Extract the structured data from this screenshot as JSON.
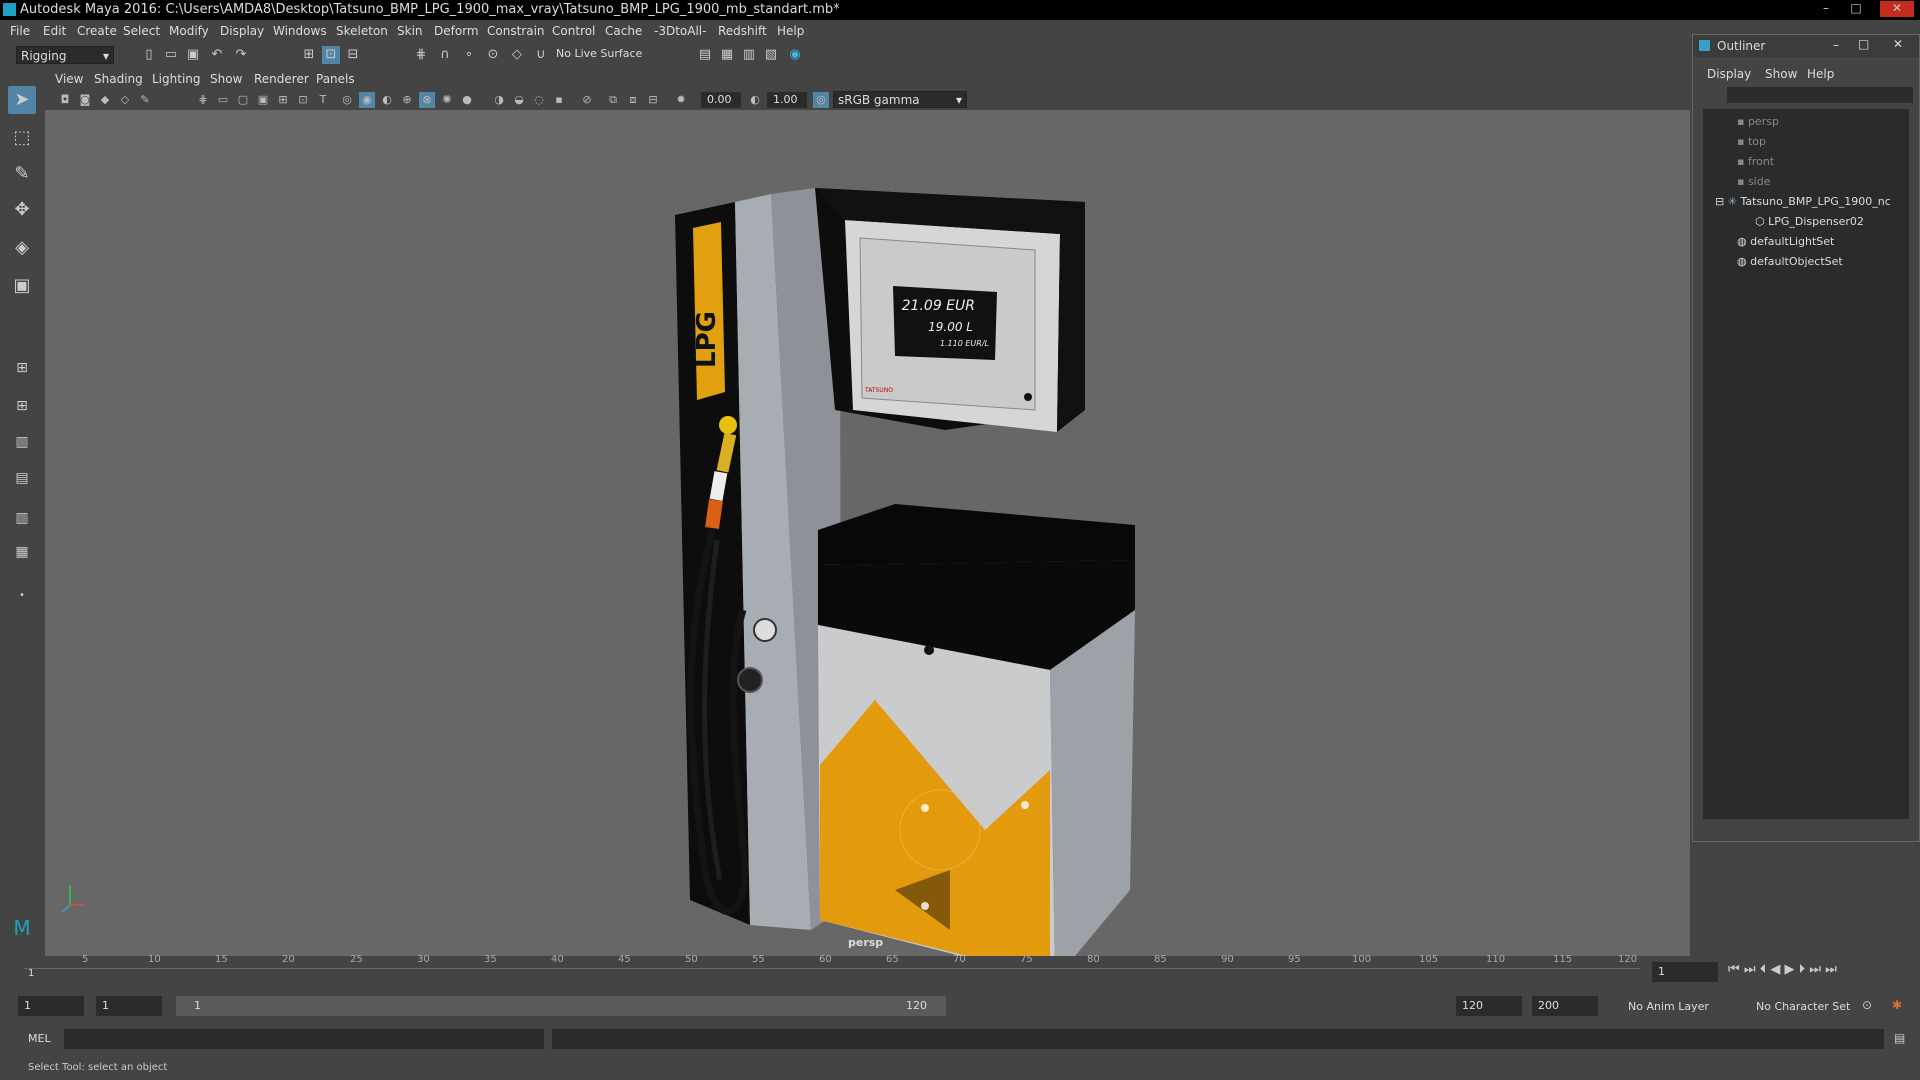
{
  "window": {
    "title": "Autodesk Maya 2016: C:\\Users\\AMDA8\\Desktop\\Tatsuno_BMP_LPG_1900_max_vray\\Tatsuno_BMP_LPG_1900_mb_standart.mb*",
    "buttons": [
      "–",
      "□",
      "✕"
    ]
  },
  "menubar": [
    "File",
    "Edit",
    "Create",
    "Select",
    "Modify",
    "Display",
    "Windows",
    "Skeleton",
    "Skin",
    "Deform",
    "Constrain",
    "Control",
    "Cache",
    "-3DtoAll-",
    "Redshift",
    "Help"
  ],
  "shelf": {
    "mode": "Rigging",
    "live_surface": "No Live Surface"
  },
  "viewport": {
    "menu": [
      "View",
      "Shading",
      "Lighting",
      "Show",
      "Renderer",
      "Panels"
    ],
    "exposure": "0.00",
    "gamma": "1.00",
    "color_space": "sRGB gamma",
    "camera_label": "persp"
  },
  "model": {
    "brand_label": "LPG",
    "display_line1": "21.09 EUR",
    "display_line2": "19.00 L",
    "display_line3": "1.110 EUR/L",
    "maker": "TATSUNO"
  },
  "outliner": {
    "title": "Outliner",
    "menu": [
      "Display",
      "Show",
      "Help"
    ],
    "items": [
      {
        "label": "persp",
        "dim": true
      },
      {
        "label": "top",
        "dim": true
      },
      {
        "label": "front",
        "dim": true
      },
      {
        "label": "side",
        "dim": true
      },
      {
        "label": "Tatsuno_BMP_LPG_1900_nc",
        "dim": false
      },
      {
        "label": "LPG_Dispenser02",
        "dim": false
      },
      {
        "label": "defaultLightSet",
        "dim": false
      },
      {
        "label": "defaultObjectSet",
        "dim": false
      }
    ]
  },
  "timeline": {
    "ticks": [
      "5",
      "10",
      "15",
      "20",
      "25",
      "30",
      "35",
      "40",
      "45",
      "50",
      "55",
      "60",
      "65",
      "70",
      "75",
      "80",
      "85",
      "90",
      "95",
      "100",
      "105",
      "110",
      "115",
      "120"
    ],
    "start_marker": "1",
    "current_frame": "1"
  },
  "range": {
    "start": "1",
    "playback_start": "1",
    "slider_start": "1",
    "slider_end": "120",
    "playback_end": "120",
    "end": "200",
    "anim_layer": "No Anim Layer",
    "char_set": "No Character Set"
  },
  "cmdline": {
    "lang": "MEL"
  },
  "help_line": "Select Tool: select an object"
}
